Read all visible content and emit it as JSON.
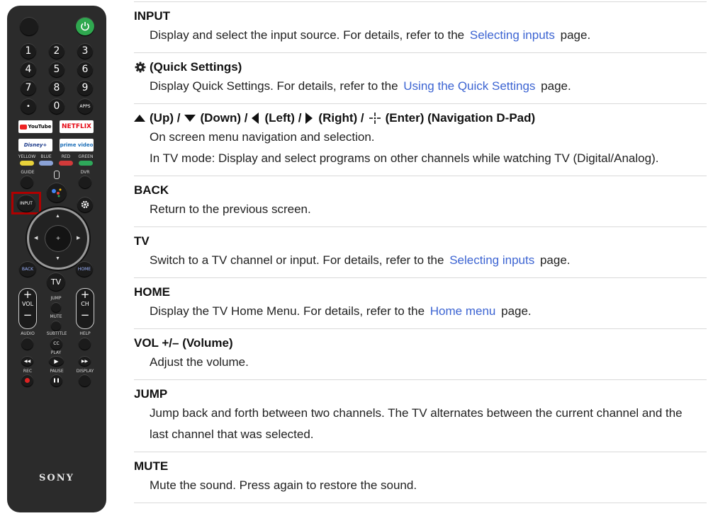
{
  "remote": {
    "brand": "SONY",
    "digits": [
      "1",
      "2",
      "3",
      "4",
      "5",
      "6",
      "7",
      "8",
      "9",
      "•",
      "0",
      "APPS"
    ],
    "services": {
      "youtube": "YouTube",
      "netflix": "NETFLIX",
      "disney": "Disney+",
      "prime": "prime video"
    },
    "color_labels": [
      "YELLOW",
      "BLUE",
      "RED",
      "GREEN"
    ],
    "colors": [
      "#e8d23a",
      "#8aa2d6",
      "#d23a3a",
      "#2ea85a"
    ],
    "guide": "GUIDE",
    "dvr": "DVR",
    "input": "INPUT",
    "back": "BACK",
    "home": "HOME",
    "tv": "TV",
    "vol": "VOL",
    "ch": "CH",
    "jump": "JUMP",
    "mute": "MUTE",
    "audio": "AUDIO",
    "subtitle": "SUBTITLE",
    "cc": "CC",
    "help": "HELP",
    "play": "PLAY",
    "rec": "REC",
    "pause": "PAUSE",
    "display": "DISPLAY",
    "plus": "+",
    "minus": "−",
    "power_color": "#2fa84f",
    "highlight_color": "#b00000"
  },
  "entries": [
    {
      "title": "INPUT",
      "pre": "Display and select the input source. For details, refer to the",
      "link": "Selecting inputs",
      "post": "page."
    },
    {
      "title": "(Quick Settings)",
      "pre": "Display Quick Settings. For details, refer to the",
      "link": "Using the Quick Settings",
      "post": "page."
    },
    {
      "nav": {
        "up": "(Up) /",
        "down": "(Down) /",
        "left": "(Left) /",
        "right": "(Right) /",
        "enter": "(Enter) (Navigation D-Pad)"
      },
      "line1": "On screen menu navigation and selection.",
      "line2": "In TV mode: Display and select programs on other channels while watching TV (Digital/Analog)."
    },
    {
      "title": "BACK",
      "desc": "Return to the previous screen."
    },
    {
      "title": "TV",
      "pre": "Switch to a TV channel or input. For details, refer to the",
      "link": "Selecting inputs",
      "post": "page."
    },
    {
      "title": "HOME",
      "pre": "Display the TV Home Menu. For details, refer to the",
      "link": "Home menu",
      "post": "page."
    },
    {
      "title": "VOL +/– (Volume)",
      "desc": "Adjust the volume."
    },
    {
      "title": "JUMP",
      "line1": "Jump back and forth between two channels. The TV alternates between the current channel and the",
      "line2": "last channel that was selected."
    },
    {
      "title": "MUTE",
      "desc": "Mute the sound. Press again to restore the sound."
    }
  ],
  "link_color": "#3c64d2"
}
